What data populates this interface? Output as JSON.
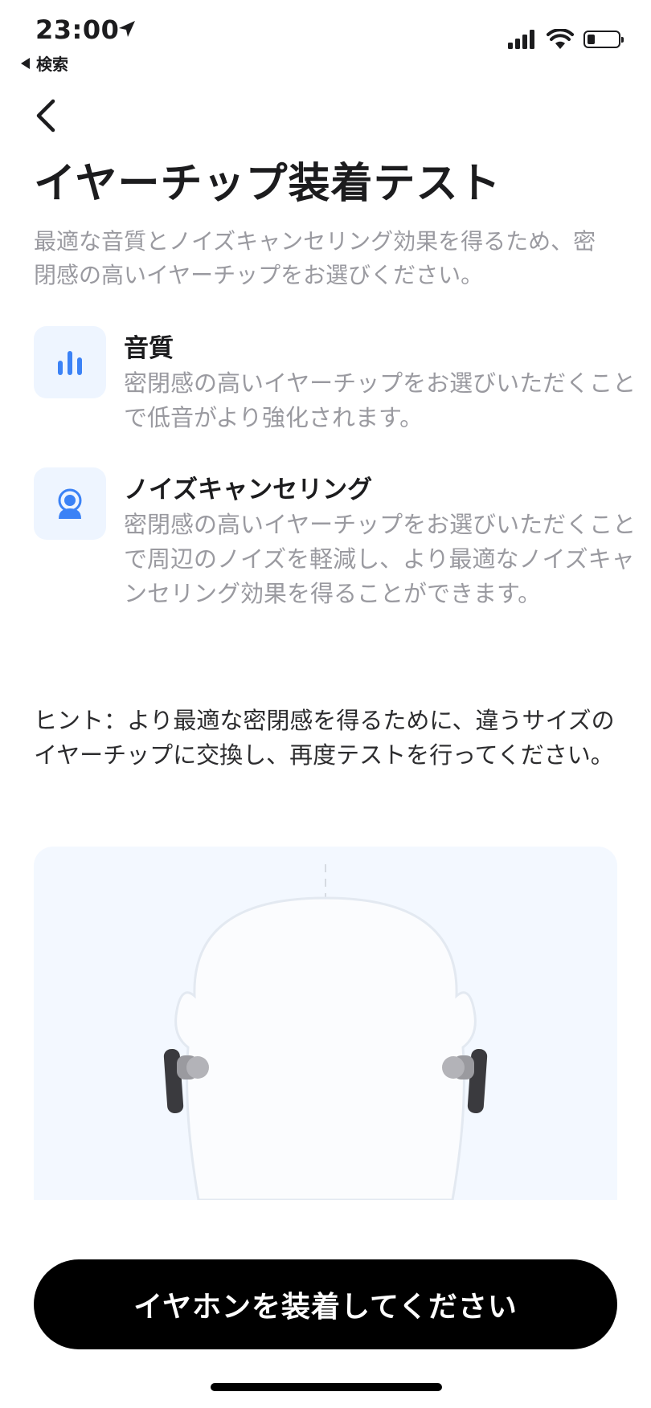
{
  "status_bar": {
    "time": "23:00",
    "back_app_label": "検索",
    "battery_level": 0.25,
    "icons": [
      "location-arrow-icon",
      "signal-icon",
      "wifi-icon",
      "battery-icon"
    ]
  },
  "nav": {
    "back_icon": "chevron-left-icon"
  },
  "page": {
    "title": "イヤーチップ装着テスト",
    "subtitle": "最適な音質とノイズキャンセリング効果を得るため、密閉感の高いイヤーチップをお選びください。"
  },
  "features": [
    {
      "icon": "equalizer-bars-icon",
      "title": "音質",
      "description": "密閉感の高いイヤーチップをお選びいただくことで低音がより強化されます。"
    },
    {
      "icon": "person-noise-cancel-icon",
      "title": "ノイズキャンセリング",
      "description": "密閉感の高いイヤーチップをお選びいただくことで周辺のノイズを軽減し、より最適なノイズキャンセリング効果を得ることができます。"
    }
  ],
  "hint": "ヒント：より最適な密閉感を得るために、違うサイズのイヤーチップに交換し、再度テストを行ってください。",
  "primary_button": {
    "label": "イヤホンを装着してください"
  },
  "colors": {
    "accent": "#3b82f6",
    "icon_bg": "#eef5ff",
    "secondary_text": "#9a9aa0",
    "illustration_bg": "#f3f8ff",
    "button_bg": "#000000"
  }
}
